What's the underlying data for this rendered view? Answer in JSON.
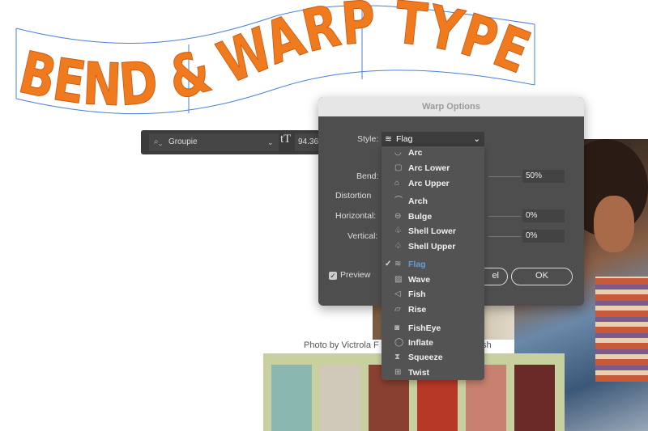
{
  "artwork": {
    "title": "BEND & WARP TYPE",
    "fill": "#f07a1e",
    "guide_color": "#4a7fd8"
  },
  "toolbar": {
    "font_icon": "search-icon",
    "font_name": "Groupie",
    "size_icon": "tT",
    "font_size": "94.36"
  },
  "captions": {
    "left": "Photo by Victrola F",
    "right": "sh"
  },
  "dialog": {
    "title": "Warp Options",
    "style_label": "Style:",
    "style_value": "Flag",
    "bend_label": "Bend:",
    "bend_value": "50%",
    "distortion_label": "Distortion",
    "horizontal_label": "Horizontal:",
    "horizontal_value": "0%",
    "vertical_label": "Vertical:",
    "vertical_value": "0%",
    "preview_label": "Preview",
    "preview_checked": true,
    "cancel_fragment": "el",
    "ok_label": "OK"
  },
  "menu": {
    "items": [
      {
        "label": "Arc",
        "icon": "arc-icon",
        "glyph": "◡"
      },
      {
        "label": "Arc Lower",
        "icon": "arc-lower-icon",
        "glyph": "▢"
      },
      {
        "label": "Arc Upper",
        "icon": "arc-upper-icon",
        "glyph": "⌂"
      },
      {
        "label": "Arch",
        "icon": "arch-icon",
        "glyph": "⌒"
      },
      {
        "label": "Bulge",
        "icon": "bulge-icon",
        "glyph": "⊖"
      },
      {
        "label": "Shell Lower",
        "icon": "shell-lower-icon",
        "glyph": "♧"
      },
      {
        "label": "Shell Upper",
        "icon": "shell-upper-icon",
        "glyph": "♤"
      },
      {
        "label": "Flag",
        "icon": "flag-icon",
        "glyph": "≋",
        "selected": true
      },
      {
        "label": "Wave",
        "icon": "wave-icon",
        "glyph": "▨"
      },
      {
        "label": "Fish",
        "icon": "fish-icon",
        "glyph": "◁"
      },
      {
        "label": "Rise",
        "icon": "rise-icon",
        "glyph": "▱"
      },
      {
        "label": "FishEye",
        "icon": "fisheye-icon",
        "glyph": "◙"
      },
      {
        "label": "Inflate",
        "icon": "inflate-icon",
        "glyph": "◯"
      },
      {
        "label": "Squeeze",
        "icon": "squeeze-icon",
        "glyph": "⧗"
      },
      {
        "label": "Twist",
        "icon": "twist-icon",
        "glyph": "⊞"
      }
    ]
  }
}
